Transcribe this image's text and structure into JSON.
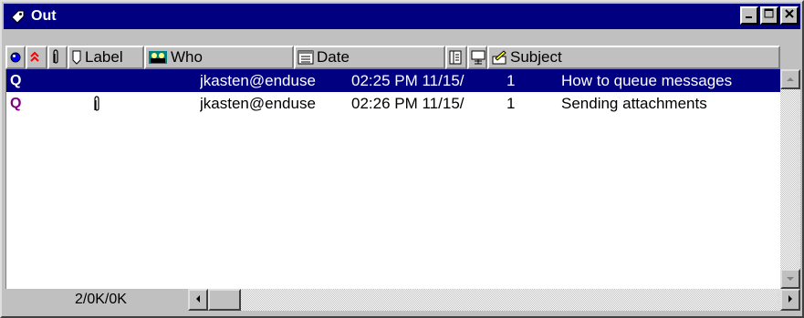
{
  "window": {
    "title": "Out",
    "title_bar_color": "#000080",
    "controls": [
      "minimize-icon",
      "maximize-icon",
      "close-icon"
    ]
  },
  "columns": [
    {
      "key": "read",
      "icon": "unread-dot-icon",
      "label": ""
    },
    {
      "key": "priority",
      "icon": "priority-arrows-icon",
      "label": ""
    },
    {
      "key": "attach",
      "icon": "paperclip-icon",
      "label": ""
    },
    {
      "key": "label",
      "icon": "label-tag-icon",
      "label": "Label"
    },
    {
      "key": "who",
      "icon": "people-icon",
      "label": "Who"
    },
    {
      "key": "date",
      "icon": "calendar-icon",
      "label": "Date"
    },
    {
      "key": "size",
      "icon": "page-icon",
      "label": ""
    },
    {
      "key": "server",
      "icon": "server-icon",
      "label": ""
    },
    {
      "key": "subject",
      "icon": "pencil-icon",
      "label": "Subject"
    }
  ],
  "messages": [
    {
      "status": "Q",
      "attachment": false,
      "who": "jkasten@enduse",
      "date": "02:25 PM 11/15/",
      "size": "1",
      "subject": "How to queue messages",
      "selected": true
    },
    {
      "status": "Q",
      "attachment": true,
      "who": "jkasten@enduse",
      "date": "02:26 PM 11/15/",
      "size": "1",
      "subject": "Sending attachments",
      "selected": false
    }
  ],
  "status": {
    "text": "2/0K/0K"
  },
  "colors": {
    "selection": "#000080",
    "queued": "#800080",
    "priority": "#ff0000",
    "read_dot": "#0000ff"
  }
}
